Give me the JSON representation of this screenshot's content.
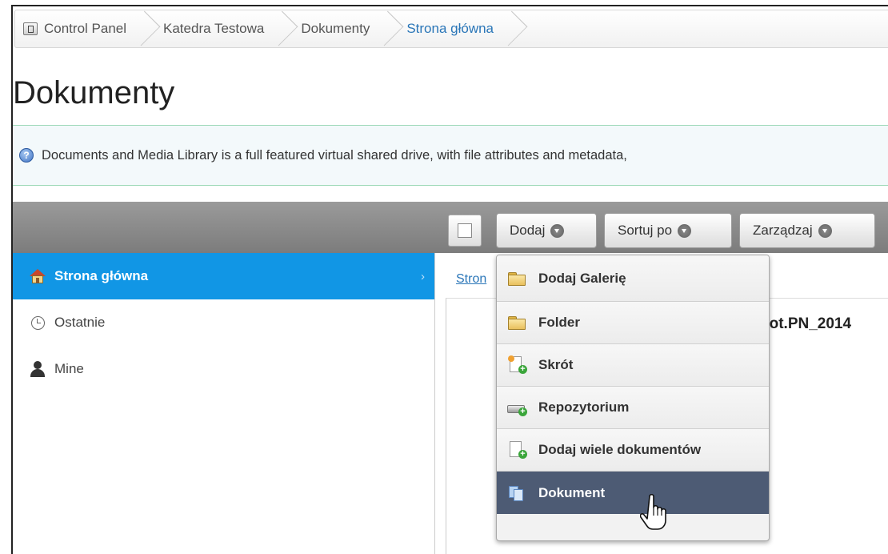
{
  "breadcrumb": {
    "items": [
      {
        "label": "Control Panel"
      },
      {
        "label": "Katedra Testowa"
      },
      {
        "label": "Dokumenty"
      },
      {
        "label": "Strona główna"
      }
    ]
  },
  "page": {
    "title": "Dokumenty",
    "info": "Documents and Media Library is a full featured virtual shared drive, with file attributes and metadata,"
  },
  "sidebar": {
    "items": [
      {
        "label": "Strona główna",
        "icon": "home-icon",
        "active": true
      },
      {
        "label": "Ostatnie",
        "icon": "clock-icon"
      },
      {
        "label": "Mine",
        "icon": "user-icon"
      }
    ]
  },
  "toolbar": {
    "add_label": "Dodaj",
    "sort_label": "Sortuj po",
    "manage_label": "Zarządzaj"
  },
  "main": {
    "breadcrumb_partial": "Stron",
    "doc_title_partial": "Fot.PN_2014"
  },
  "dropdown": {
    "items": [
      {
        "label": "Dodaj Galerię",
        "icon": "folder-icon"
      },
      {
        "label": "Folder",
        "icon": "folder-icon"
      },
      {
        "label": "Skrót",
        "icon": "shortcut-icon"
      },
      {
        "label": "Repozytorium",
        "icon": "repository-icon"
      },
      {
        "label": "Dodaj wiele dokumentów",
        "icon": "multiple-documents-icon"
      },
      {
        "label": "Dokument",
        "icon": "document-icon",
        "hovered": true
      }
    ]
  },
  "colors": {
    "accent": "#1196e5",
    "menu_hover": "#4d5b74",
    "link": "#2a76b8"
  }
}
